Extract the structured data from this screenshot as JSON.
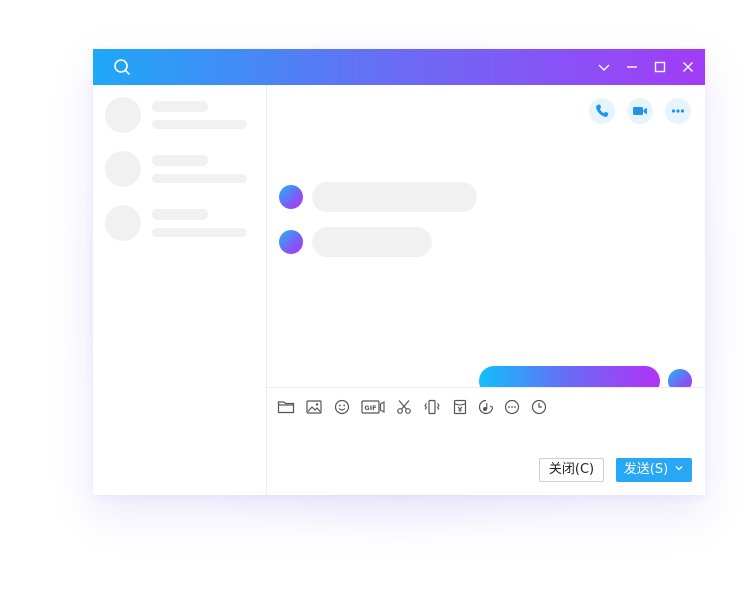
{
  "theme": {
    "accent": "#27a7f5",
    "gradient_start": "#1ea8f6",
    "gradient_end": "#a23cf6"
  },
  "titlebar": {
    "icons": [
      "search-icon",
      "chevron-down-icon",
      "minimize-icon",
      "maximize-icon",
      "close-icon"
    ]
  },
  "sidebar": {
    "contact_count": 3
  },
  "chat": {
    "actions": [
      "phone-icon",
      "video-icon",
      "more-icon"
    ],
    "messages": [
      {
        "side": "incoming"
      },
      {
        "side": "incoming"
      },
      {
        "side": "outgoing"
      }
    ]
  },
  "compose": {
    "toolbar": [
      "folder-icon",
      "image-icon",
      "emoji-icon",
      "gif-icon",
      "scissors-icon",
      "shake-icon",
      "red-packet-icon",
      "music-icon",
      "more-circle-icon",
      "history-icon"
    ],
    "gif_label": "GIF",
    "close_label": "关闭(C)",
    "send_label": "发送(S)"
  }
}
